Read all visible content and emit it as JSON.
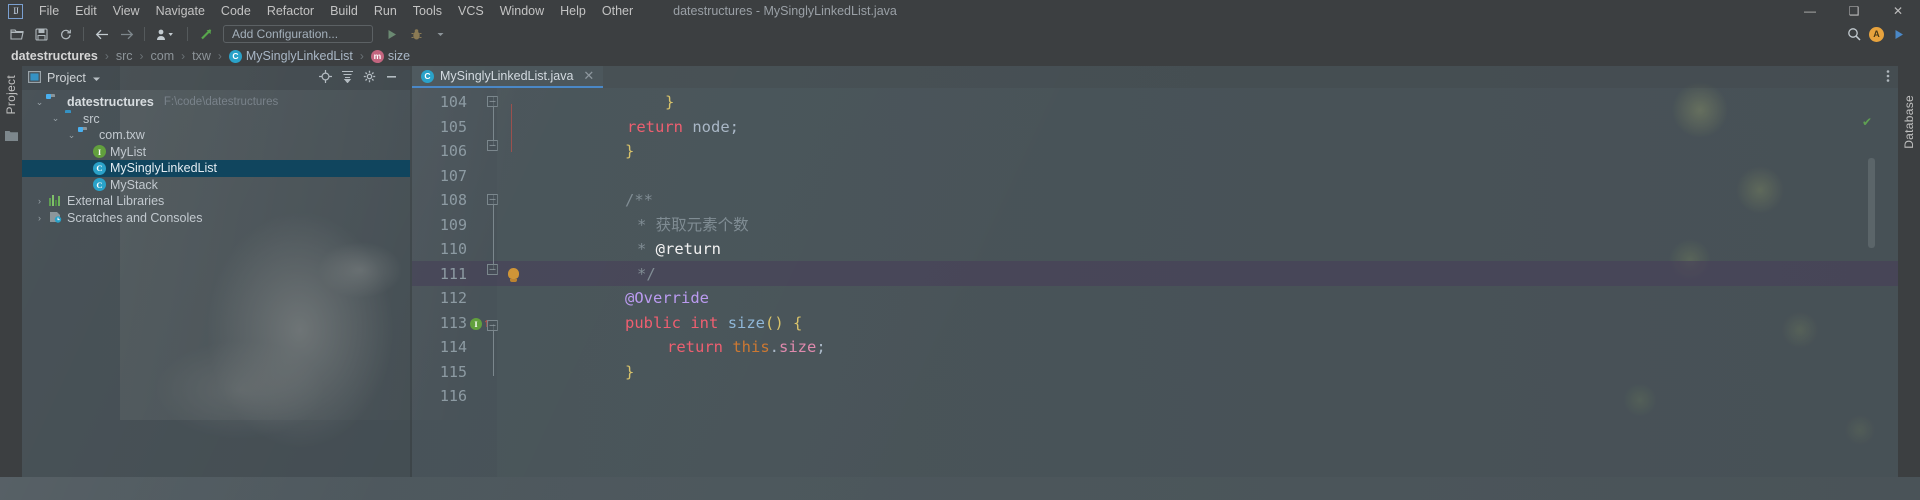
{
  "window": {
    "title": "datestructures - MySinglyLinkedList.java",
    "minimize": "—",
    "maximize": "❑",
    "close": "✕"
  },
  "menubar": {
    "logo": "IJ",
    "items": [
      {
        "label": "File"
      },
      {
        "label": "Edit"
      },
      {
        "label": "View"
      },
      {
        "label": "Navigate"
      },
      {
        "label": "Code"
      },
      {
        "label": "Refactor"
      },
      {
        "label": "Build"
      },
      {
        "label": "Run"
      },
      {
        "label": "Tools"
      },
      {
        "label": "VCS"
      },
      {
        "label": "Window"
      },
      {
        "label": "Help"
      },
      {
        "label": "Other"
      }
    ]
  },
  "toolbar": {
    "open_icon": "open-folder-icon",
    "save_icon": "save-icon",
    "sync_icon": "refresh-icon",
    "back_icon": "arrow-left-icon",
    "forward_icon": "arrow-right-icon",
    "vcs_icon": "user-group-icon",
    "update_icon": "vcs-update-icon",
    "run_config": "Add Configuration...",
    "run_icon": "run-icon",
    "debug_icon": "debug-icon",
    "search_icon": "search-icon",
    "avatar_initial": "A",
    "play_icon": "play-icon"
  },
  "breadcrumb": {
    "items": [
      {
        "label": "datestructures",
        "icon": "",
        "style": "root"
      },
      {
        "label": "src",
        "icon": "",
        "style": "dim"
      },
      {
        "label": "com",
        "icon": "",
        "style": "dim"
      },
      {
        "label": "txw",
        "icon": "",
        "style": "dim"
      },
      {
        "label": "MySinglyLinkedList",
        "icon": "class-icon",
        "style": "normal"
      },
      {
        "label": "size",
        "icon": "method-icon",
        "style": "normal"
      }
    ],
    "separator": "›"
  },
  "left_strip": {
    "project_label": "Project",
    "structure_icon": "folder-icon"
  },
  "right_strip": {
    "database_label": "Database"
  },
  "project_panel": {
    "title": "Project",
    "dropdown_icon": "chevron-down-icon",
    "locate_icon": "target-icon",
    "collapse_icon": "collapse-all-icon",
    "settings_icon": "gear-icon",
    "hide_icon": "minimize-icon",
    "tree": [
      {
        "label": "datestructures",
        "path": "F:\\code\\datestructures",
        "indent": 0,
        "arrow": "⌄",
        "icon": "project-folder-icon",
        "bold": true,
        "selected": false
      },
      {
        "label": "src",
        "path": "",
        "indent": 1,
        "arrow": "⌄",
        "icon": "source-folder-icon",
        "bold": false,
        "selected": false
      },
      {
        "label": "com.txw",
        "path": "",
        "indent": 2,
        "arrow": "⌄",
        "icon": "package-icon",
        "bold": false,
        "selected": false
      },
      {
        "label": "MyList",
        "path": "",
        "indent": 3,
        "arrow": "",
        "icon": "interface-icon",
        "bold": false,
        "selected": false
      },
      {
        "label": "MySinglyLinkedList",
        "path": "",
        "indent": 3,
        "arrow": "",
        "icon": "class-icon",
        "bold": false,
        "selected": true
      },
      {
        "label": "MyStack",
        "path": "",
        "indent": 3,
        "arrow": "",
        "icon": "class-icon",
        "bold": false,
        "selected": false
      },
      {
        "label": "External Libraries",
        "path": "",
        "indent": 0,
        "arrow": "›",
        "icon": "libraries-icon",
        "bold": false,
        "selected": false
      },
      {
        "label": "Scratches and Consoles",
        "path": "",
        "indent": 0,
        "arrow": "›",
        "icon": "scratches-icon",
        "bold": false,
        "selected": false
      }
    ]
  },
  "editor": {
    "tab": {
      "label": "MySinglyLinkedList.java",
      "icon": "class-icon",
      "close": "✕"
    },
    "more_icon": "more-options-icon",
    "inspection_ok_icon": "check-icon",
    "caret_line": 111,
    "lines": [
      {
        "num": "104",
        "indent": 8,
        "tokens": [
          {
            "t": "}",
            "c": "br"
          }
        ]
      },
      {
        "num": "105",
        "indent": 12,
        "tokens": [
          {
            "t": "return",
            "c": "kw2"
          },
          {
            "t": " ",
            "c": "id"
          },
          {
            "t": "node",
            "c": "id"
          },
          {
            "t": ";",
            "c": "id"
          }
        ]
      },
      {
        "num": "106",
        "indent": 4,
        "tokens": [
          {
            "t": "}",
            "c": "br"
          }
        ]
      },
      {
        "num": "107",
        "indent": 0,
        "tokens": []
      },
      {
        "num": "108",
        "indent": 4,
        "tokens": [
          {
            "t": "/**",
            "c": "cmt"
          }
        ]
      },
      {
        "num": "109",
        "indent": 5,
        "tokens": [
          {
            "t": "* 获取元素个数",
            "c": "cmt"
          }
        ]
      },
      {
        "num": "110",
        "indent": 5,
        "tokens": [
          {
            "t": "* ",
            "c": "cmt"
          },
          {
            "t": "@return",
            "c": "tag"
          }
        ]
      },
      {
        "num": "111",
        "indent": 5,
        "tokens": [
          {
            "t": "*/",
            "c": "cmt"
          }
        ]
      },
      {
        "num": "112",
        "indent": 4,
        "tokens": [
          {
            "t": "@Override",
            "c": "ann"
          }
        ]
      },
      {
        "num": "113",
        "indent": 4,
        "tokens": [
          {
            "t": "public",
            "c": "kw2"
          },
          {
            "t": " ",
            "c": "id"
          },
          {
            "t": "int",
            "c": "kw2"
          },
          {
            "t": " ",
            "c": "id"
          },
          {
            "t": "size",
            "c": "mth"
          },
          {
            "t": "()",
            "c": "br"
          },
          {
            "t": " ",
            "c": "id"
          },
          {
            "t": "{",
            "c": "br"
          }
        ]
      },
      {
        "num": "114",
        "indent": 8,
        "tokens": [
          {
            "t": "return",
            "c": "kw2"
          },
          {
            "t": " ",
            "c": "id"
          },
          {
            "t": "this",
            "c": "kw"
          },
          {
            "t": ".",
            "c": "id"
          },
          {
            "t": "size",
            "c": "fld"
          },
          {
            "t": ";",
            "c": "id"
          }
        ]
      },
      {
        "num": "115",
        "indent": 4,
        "tokens": [
          {
            "t": "}",
            "c": "br"
          }
        ]
      },
      {
        "num": "116",
        "indent": 0,
        "tokens": []
      }
    ],
    "gutter_marks": {
      "bulb_line": "111",
      "impl_line": "113",
      "impl_badge": "I",
      "impl_arrow": "↑"
    }
  },
  "colors": {
    "accent": "#4a88c7",
    "selection": "#10455e",
    "caret_row": "#4a3e5c",
    "keyword": "#ef5f70",
    "comment": "#808d94",
    "annotation": "#bb9bf0",
    "field": "#e08aae",
    "bracket": "#d9c36a",
    "method": "#8fb7d8"
  }
}
